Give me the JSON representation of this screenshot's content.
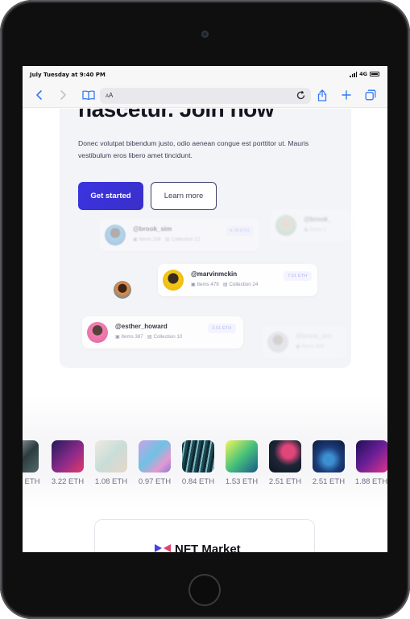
{
  "status_bar": {
    "time": "July Tuesday at 9:40 PM",
    "network": "4G"
  },
  "browser": {
    "address_text": "AA"
  },
  "hero": {
    "title": "nascetur. Join now",
    "description": "Donec volutpat bibendum justo, odio aenean congue est porttitor ut. Mauris vestibulum eros libero amet tincidunt.",
    "primary_button": "Get started",
    "secondary_button": "Learn more"
  },
  "creators": [
    {
      "name": "@brook_sim",
      "items": "Items 208",
      "collection": "Collection 12",
      "price": "4.78 ETH"
    },
    {
      "name": "@brook_",
      "items": "Items 2",
      "collection": "",
      "price": ""
    },
    {
      "name": "@marvinmckin",
      "items": "Items 479",
      "collection": "Collection 24",
      "price": "7.51 ETH"
    },
    {
      "name": "@esther_howard",
      "items": "Items 387",
      "collection": "Collection 10",
      "price": "3.51 ETH"
    },
    {
      "name": "@brook_sim",
      "items": "Items 208",
      "collection": "",
      "price": ""
    }
  ],
  "nfts": [
    {
      "price": "ETH",
      "colors": [
        "#9aa3a8",
        "#2c3c3e"
      ]
    },
    {
      "price": "3.22 ETH",
      "colors": [
        "#2a1e63",
        "#c2287a"
      ]
    },
    {
      "price": "1.08 ETH",
      "colors": [
        "#e9e4dc",
        "#b6d3cf"
      ]
    },
    {
      "price": "0.97 ETH",
      "colors": [
        "#b99de0",
        "#6ec2e3"
      ]
    },
    {
      "price": "0.84 ETH",
      "colors": [
        "#1a3940",
        "#7bb7c2"
      ]
    },
    {
      "price": "1.53 ETH",
      "colors": [
        "#e8f53a",
        "#1b9a6f"
      ]
    },
    {
      "price": "2.51 ETH",
      "colors": [
        "#1b2533",
        "#c23d68"
      ]
    },
    {
      "price": "2.51 ETH",
      "colors": [
        "#142a5c",
        "#3c8fd1"
      ]
    },
    {
      "price": "1.88 ETH",
      "colors": [
        "#2a1366",
        "#d12d8c"
      ]
    }
  ],
  "footer_brand": "NFT Market",
  "colors": {
    "accent": "#3b34e0",
    "card_bg": "#f3f4f8",
    "text": "#14151f"
  }
}
